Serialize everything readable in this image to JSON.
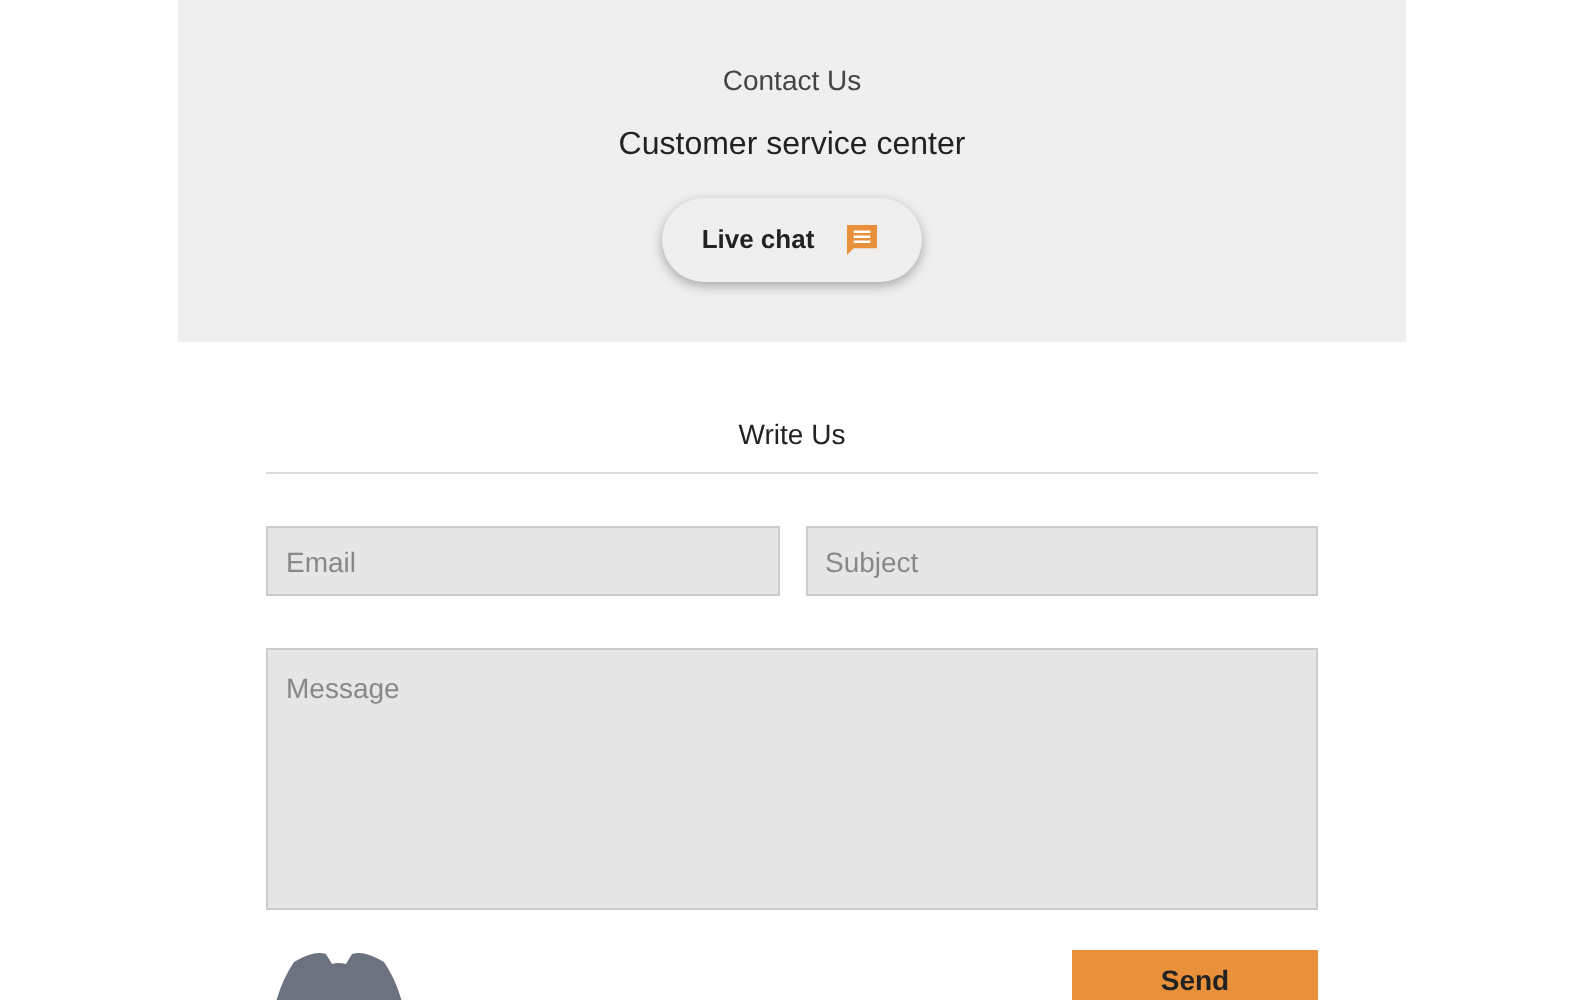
{
  "contact": {
    "heading": "Contact Us",
    "subtitle": "Customer service center",
    "live_chat_button": "Live chat"
  },
  "write_us": {
    "heading": "Write Us",
    "fields": [
      {
        "placeholder": "Email"
      },
      {
        "placeholder": "Subject"
      }
    ],
    "message": {
      "placeholder": "Message"
    },
    "send_button": "Send"
  }
}
